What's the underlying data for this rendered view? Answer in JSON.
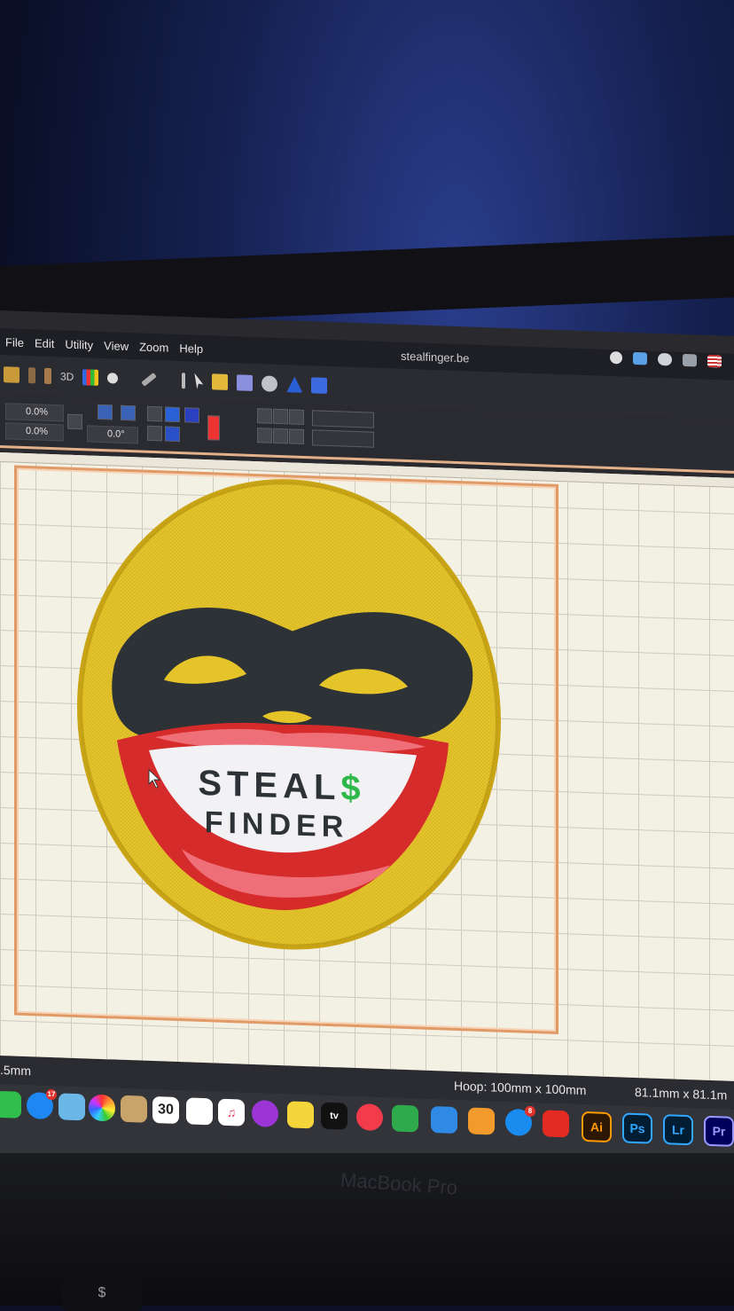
{
  "app": {
    "window_title": "stealfinger.be",
    "menu": [
      "File",
      "Edit",
      "Utility",
      "View",
      "Zoom",
      "Help"
    ]
  },
  "toolbar": {
    "view3d_label": "3D"
  },
  "properties": {
    "scale_x": "0.0%",
    "scale_y": "0.0%",
    "rotation": "0.0°"
  },
  "design": {
    "text_line1": "STEAL$",
    "text_line2": "FINDER",
    "colors": {
      "face": "#e5c42a",
      "mask": "#2d3236",
      "lips": "#d62b2b",
      "lips_light": "#ef6f78",
      "teeth": "#f2f2f4",
      "dollar": "#2eb84a"
    }
  },
  "status": {
    "left_readout": ".5mm",
    "hoop": "Hoop: 100mm x 100mm",
    "size": "81.1mm x 81.1m"
  },
  "dock": {
    "calendar_day": "30",
    "messages_badge": "17",
    "appstore_badge": "8",
    "illustrator": "Ai",
    "photoshop": "Ps",
    "lightroom": "Lr",
    "premiere": "Pr",
    "appletv": "tv"
  },
  "hardware": {
    "brand": "MacBook Pro",
    "key": "$"
  }
}
